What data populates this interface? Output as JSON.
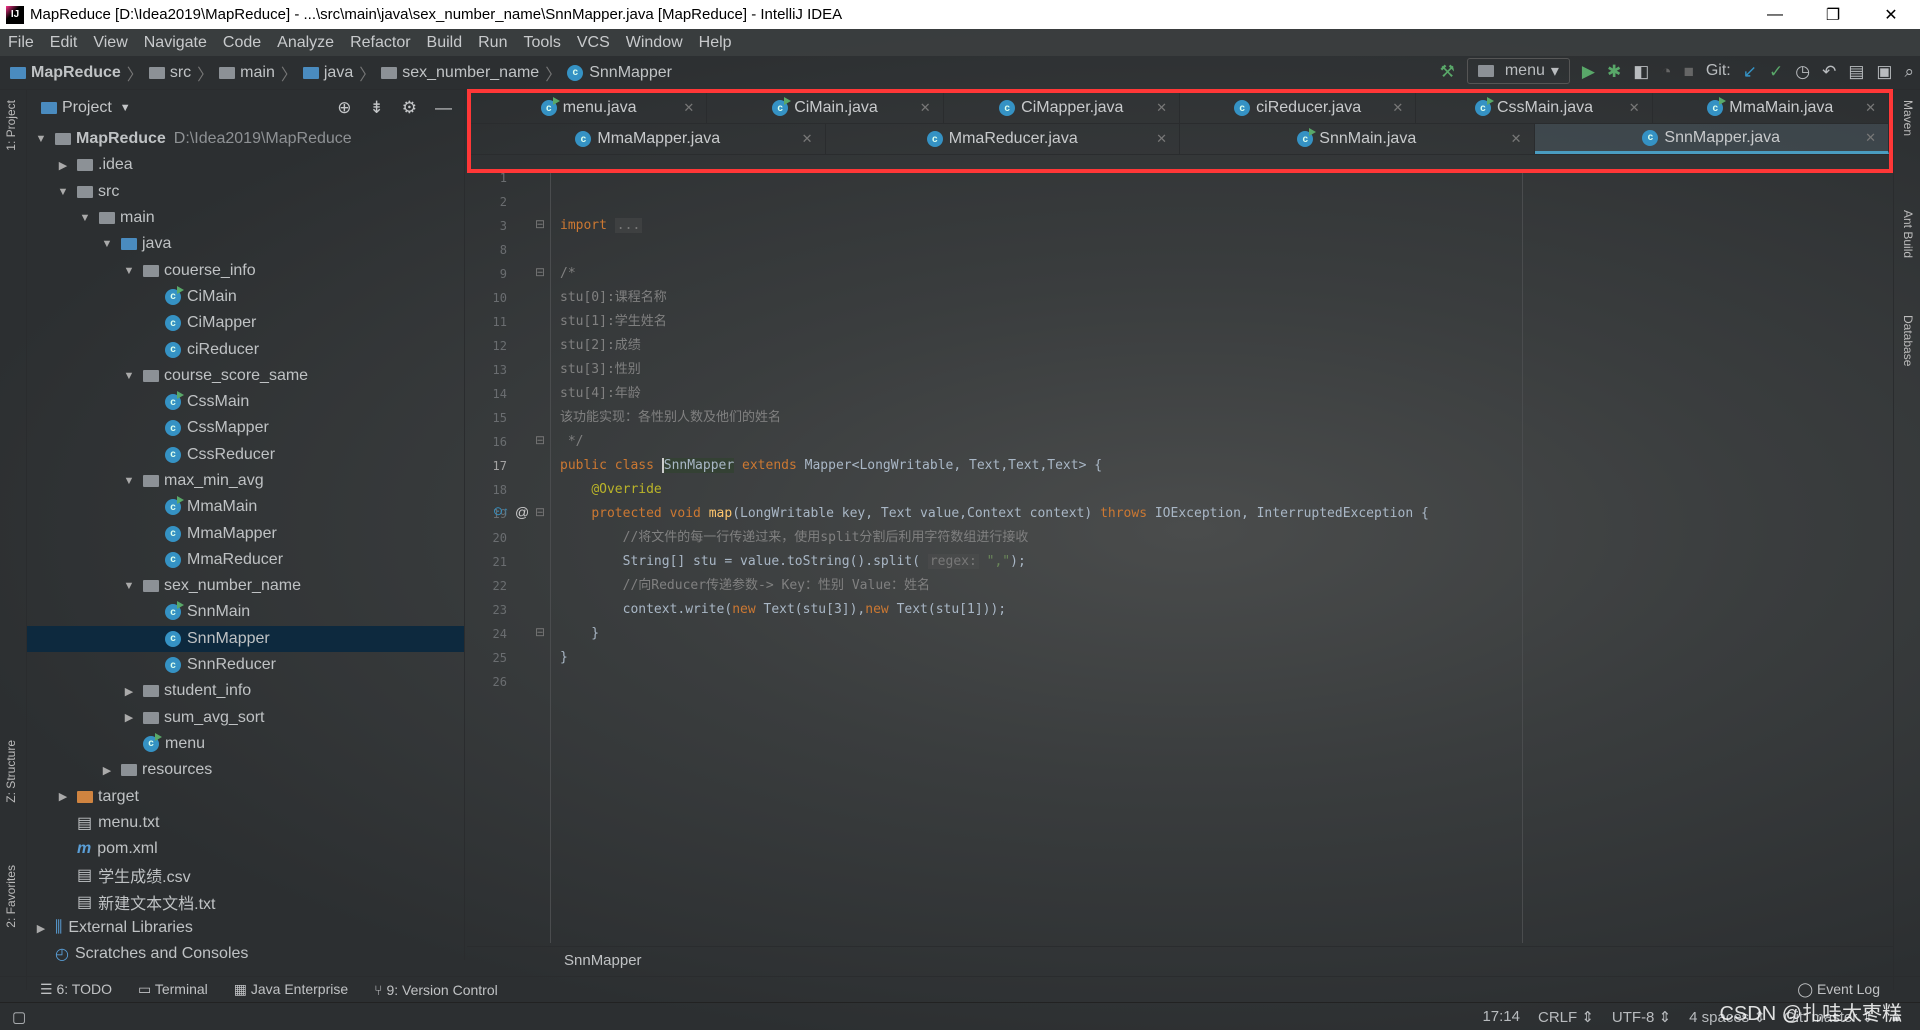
{
  "window": {
    "title": "MapReduce [D:\\Idea2019\\MapReduce] - ...\\src\\main\\java\\sex_number_name\\SnnMapper.java [MapReduce] - IntelliJ IDEA",
    "minimize": "—",
    "maximize": "❐",
    "close": "✕"
  },
  "menu": [
    "File",
    "Edit",
    "View",
    "Navigate",
    "Code",
    "Analyze",
    "Refactor",
    "Build",
    "Run",
    "Tools",
    "VCS",
    "Window",
    "Help"
  ],
  "breadcrumb": [
    "MapReduce",
    "src",
    "main",
    "java",
    "sex_number_name",
    "SnnMapper"
  ],
  "toolbar": {
    "run_config": "menu",
    "git_label": "Git:"
  },
  "project": {
    "title": "Project",
    "tree": [
      {
        "label": "MapReduce",
        "path": "D:\\Idea2019\\MapReduce",
        "depth": 0,
        "kind": "module",
        "open": true
      },
      {
        "label": ".idea",
        "depth": 1,
        "kind": "folder",
        "open": false
      },
      {
        "label": "src",
        "depth": 1,
        "kind": "folder",
        "open": true
      },
      {
        "label": "main",
        "depth": 2,
        "kind": "folder",
        "open": true
      },
      {
        "label": "java",
        "depth": 3,
        "kind": "srcfolder",
        "open": true
      },
      {
        "label": "couerse_info",
        "depth": 4,
        "kind": "package",
        "open": true
      },
      {
        "label": "CiMain",
        "depth": 5,
        "kind": "runclass"
      },
      {
        "label": "CiMapper",
        "depth": 5,
        "kind": "class"
      },
      {
        "label": "ciReducer",
        "depth": 5,
        "kind": "class"
      },
      {
        "label": "course_score_same",
        "depth": 4,
        "kind": "package",
        "open": true
      },
      {
        "label": "CssMain",
        "depth": 5,
        "kind": "runclass"
      },
      {
        "label": "CssMapper",
        "depth": 5,
        "kind": "class"
      },
      {
        "label": "CssReducer",
        "depth": 5,
        "kind": "class"
      },
      {
        "label": "max_min_avg",
        "depth": 4,
        "kind": "package",
        "open": true
      },
      {
        "label": "MmaMain",
        "depth": 5,
        "kind": "runclass"
      },
      {
        "label": "MmaMapper",
        "depth": 5,
        "kind": "class"
      },
      {
        "label": "MmaReducer",
        "depth": 5,
        "kind": "class"
      },
      {
        "label": "sex_number_name",
        "depth": 4,
        "kind": "package",
        "open": true
      },
      {
        "label": "SnnMain",
        "depth": 5,
        "kind": "runclass"
      },
      {
        "label": "SnnMapper",
        "depth": 5,
        "kind": "class",
        "selected": true
      },
      {
        "label": "SnnReducer",
        "depth": 5,
        "kind": "class"
      },
      {
        "label": "student_info",
        "depth": 4,
        "kind": "package",
        "open": false
      },
      {
        "label": "sum_avg_sort",
        "depth": 4,
        "kind": "package",
        "open": false
      },
      {
        "label": "menu",
        "depth": 4,
        "kind": "runclass"
      },
      {
        "label": "resources",
        "depth": 3,
        "kind": "folder",
        "open": false
      },
      {
        "label": "target",
        "depth": 1,
        "kind": "orangefolder",
        "open": false
      },
      {
        "label": "menu.txt",
        "depth": 1,
        "kind": "file"
      },
      {
        "label": "pom.xml",
        "depth": 1,
        "kind": "maven"
      },
      {
        "label": "学生成绩.csv",
        "depth": 1,
        "kind": "file"
      },
      {
        "label": "新建文本文档.txt",
        "depth": 1,
        "kind": "file"
      },
      {
        "label": "External Libraries",
        "depth": 0,
        "kind": "libs",
        "open": false
      },
      {
        "label": "Scratches and Consoles",
        "depth": 0,
        "kind": "scratch"
      }
    ]
  },
  "tabs": {
    "row1": [
      {
        "label": "menu.java",
        "run": true
      },
      {
        "label": "CiMain.java",
        "run": true
      },
      {
        "label": "CiMapper.java"
      },
      {
        "label": "ciReducer.java"
      },
      {
        "label": "CssMain.java",
        "run": true
      },
      {
        "label": "MmaMain.java",
        "run": true
      }
    ],
    "row2": [
      {
        "label": "MmaMapper.java"
      },
      {
        "label": "MmaReducer.java"
      },
      {
        "label": "SnnMain.java",
        "run": true
      },
      {
        "label": "SnnMapper.java",
        "active": true
      }
    ]
  },
  "editor": {
    "lines": [
      {
        "n": "1",
        "tokens": []
      },
      {
        "n": "2",
        "tokens": []
      },
      {
        "n": "3",
        "fold": true,
        "tokens": [
          [
            "k",
            "import "
          ],
          [
            "h",
            "..."
          ]
        ]
      },
      {
        "n": "8",
        "tokens": []
      },
      {
        "n": "9",
        "fold": true,
        "tokens": [
          [
            "c",
            "/*"
          ]
        ]
      },
      {
        "n": "10",
        "tokens": [
          [
            "c",
            "stu[0]:课程名称"
          ]
        ]
      },
      {
        "n": "11",
        "tokens": [
          [
            "c",
            "stu[1]:学生姓名"
          ]
        ]
      },
      {
        "n": "12",
        "tokens": [
          [
            "c",
            "stu[2]:成绩"
          ]
        ]
      },
      {
        "n": "13",
        "tokens": [
          [
            "c",
            "stu[3]:性别"
          ]
        ]
      },
      {
        "n": "14",
        "tokens": [
          [
            "c",
            "stu[4]:年龄"
          ]
        ]
      },
      {
        "n": "15",
        "tokens": [
          [
            "c",
            "该功能实现：各性别人数及他们的姓名"
          ]
        ]
      },
      {
        "n": "16",
        "fold": true,
        "tokens": [
          [
            "c",
            " */"
          ]
        ]
      },
      {
        "n": "17",
        "tokens": [
          [
            "k",
            "public class "
          ],
          [
            "hl",
            "SnnMapper"
          ],
          [
            "k",
            " extends "
          ],
          [
            "t",
            "Mapper<LongWritable, Text,Text,Text> {"
          ]
        ]
      },
      {
        "n": "18",
        "tokens": [
          [
            "t",
            "    "
          ],
          [
            "a",
            "@Override"
          ]
        ]
      },
      {
        "n": "19",
        "fold": true,
        "marks": true,
        "tokens": [
          [
            "t",
            "    "
          ],
          [
            "k",
            "protected void "
          ],
          [
            "f",
            "map"
          ],
          [
            "t",
            "(LongWritable key, Text value,Context context) "
          ],
          [
            "k",
            "throws "
          ],
          [
            "t",
            "IOException, InterruptedException {"
          ]
        ]
      },
      {
        "n": "20",
        "tokens": [
          [
            "c",
            "        //将文件的每一行传递过来，使用split分割后利用字符数组进行接收"
          ]
        ]
      },
      {
        "n": "21",
        "tokens": [
          [
            "t",
            "        String[] stu = value.toString().split( "
          ],
          [
            "h",
            "regex:"
          ],
          [
            "s",
            " \",\""
          ],
          [
            "t",
            ");"
          ]
        ]
      },
      {
        "n": "22",
        "tokens": [
          [
            "c",
            "        //向Reducer传递参数-> Key：性别 Value：姓名"
          ]
        ]
      },
      {
        "n": "23",
        "tokens": [
          [
            "t",
            "        context.write("
          ],
          [
            "k",
            "new "
          ],
          [
            "t",
            "Text(stu[3]),"
          ],
          [
            "k",
            "new "
          ],
          [
            "t",
            "Text(stu[1]));"
          ]
        ]
      },
      {
        "n": "24",
        "fold": true,
        "tokens": [
          [
            "t",
            "    }"
          ]
        ]
      },
      {
        "n": "25",
        "tokens": [
          [
            "t",
            "}"
          ]
        ]
      },
      {
        "n": "26",
        "tokens": []
      }
    ],
    "breadcrumb": "SnnMapper"
  },
  "tool_windows": {
    "left_top": "1: Project",
    "left_mid": "Z: Structure",
    "left_bottom": "2: Favorites",
    "right": [
      "Maven",
      "Ant Build",
      "Database"
    ],
    "bottom": [
      "6: TODO",
      "Terminal",
      "Java Enterprise",
      "9: Version Control"
    ],
    "event_log": "Event Log"
  },
  "status": {
    "position": "17:14",
    "line_sep": "CRLF ⇕",
    "encoding": "UTF-8 ⇕",
    "indent": "4 spaces ⇕",
    "git": "Git: master ⇕"
  },
  "watermark": "CSDN @扎哇太枣糕"
}
